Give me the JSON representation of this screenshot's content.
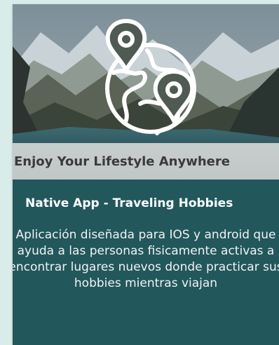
{
  "card": {
    "tagline": "Enjoy Your Lifestyle Anywhere",
    "title": "Native App - Traveling Hobbies",
    "description": "Aplicación diseñada para IOS y android que ayuda a las personas fisicamente activas a encontrar lugares nuevos donde practicar sus hobbies mientras viajan"
  },
  "colors": {
    "page_background": "#d8ece9",
    "card_background": "#22575c",
    "tagline_band": "#e6e6e4",
    "tagline_text": "#3a3a3a"
  },
  "icons": {
    "logo": "globe-with-map-pins-icon"
  }
}
